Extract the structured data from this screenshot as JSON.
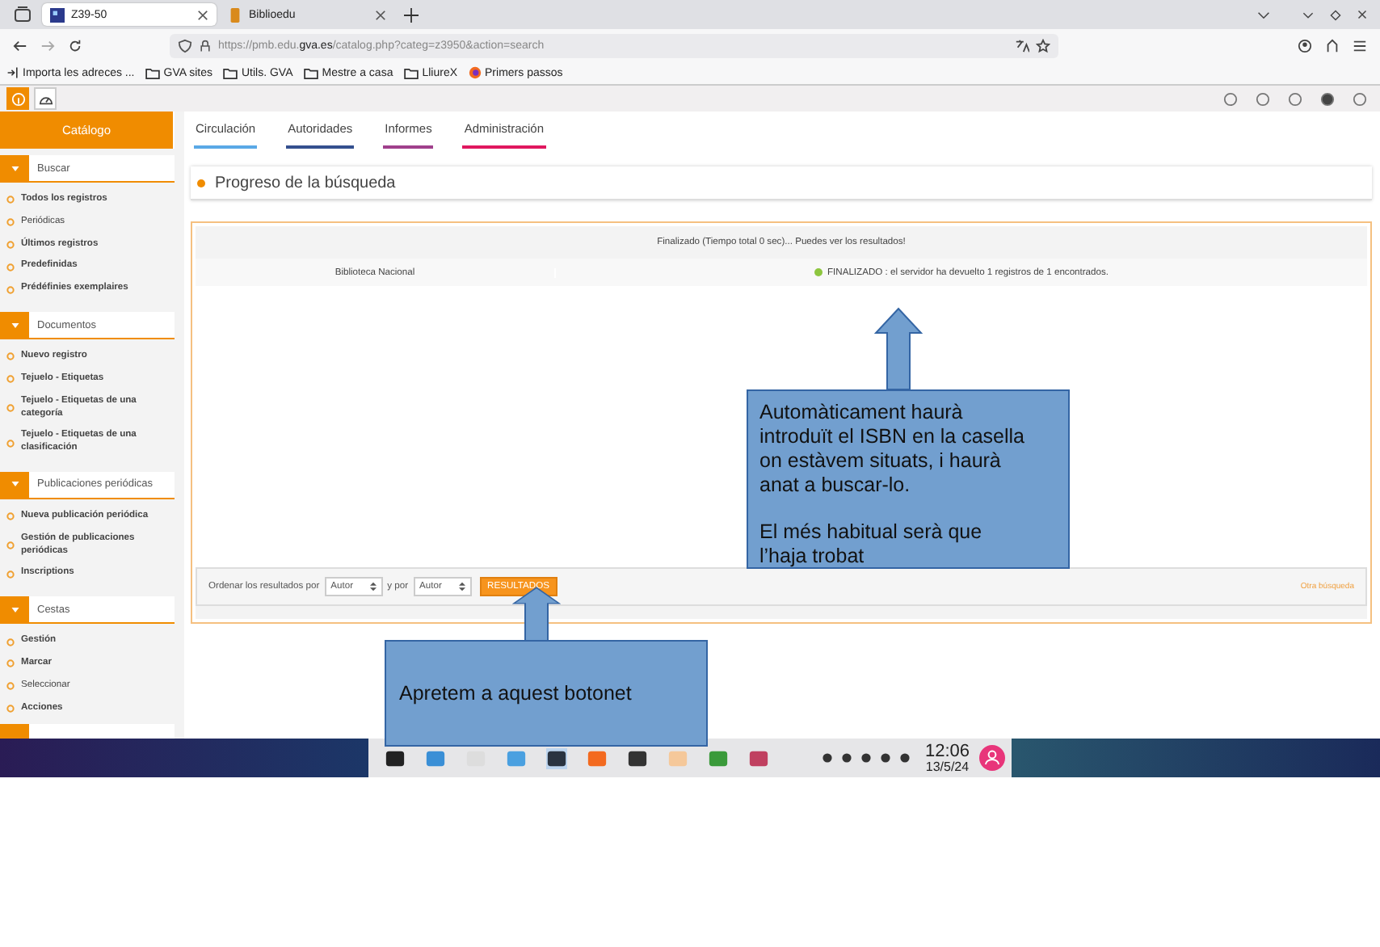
{
  "browser": {
    "tabs": [
      {
        "label": "Z39-50",
        "selected": true
      },
      {
        "label": "Biblioedu",
        "selected": false
      }
    ],
    "url": "https://pmb.edu.**gva.es**/catalog.php?categ=z3950&action=search",
    "bookmarks": [
      {
        "label": "Importa les adreces ...",
        "kind": "import"
      },
      {
        "label": "GVA sites",
        "kind": "folder"
      },
      {
        "label": "Utils. GVA",
        "kind": "folder"
      },
      {
        "label": "Mestre a casa",
        "kind": "folder"
      },
      {
        "label": "LliureX",
        "kind": "folder"
      },
      {
        "label": "Primers passos",
        "kind": "firefox"
      }
    ]
  },
  "app": {
    "module": "Catálogo",
    "nav": [
      {
        "label": "Circulación",
        "color": "#5aa9e6"
      },
      {
        "label": "Autoridades",
        "color": "#34508f"
      },
      {
        "label": "Informes",
        "color": "#a0408c"
      },
      {
        "label": "Administración",
        "color": "#e0185f"
      }
    ]
  },
  "sidebar": [
    {
      "title": "Buscar",
      "items": [
        {
          "label": "Todos los registros",
          "bold": true
        },
        {
          "label": "Periódicas",
          "bold": false
        },
        {
          "label": "Últimos registros",
          "bold": true
        },
        {
          "label": "Predefinidas",
          "bold": true
        },
        {
          "label": "Prédéfinies exemplaires",
          "bold": true
        }
      ]
    },
    {
      "title": "Documentos",
      "items": [
        {
          "label": "Nuevo registro",
          "bold": true
        },
        {
          "label": "Tejuelo - Etiquetas",
          "bold": true
        },
        {
          "label": "Tejuelo - Etiquetas de una categoría",
          "bold": true
        },
        {
          "label": "Tejuelo - Etiquetas de una clasificación",
          "bold": true
        }
      ]
    },
    {
      "title": "Publicaciones periódicas",
      "items": [
        {
          "label": "Nueva publicación periódica",
          "bold": true
        },
        {
          "label": "Gestión de publicaciones periódicas",
          "bold": true
        },
        {
          "label": "Inscriptions",
          "bold": true
        }
      ]
    },
    {
      "title": "Cestas",
      "items": [
        {
          "label": "Gestión",
          "bold": true
        },
        {
          "label": "Marcar",
          "bold": true
        },
        {
          "label": "Seleccionar",
          "bold": false
        },
        {
          "label": "Acciones",
          "bold": true
        }
      ]
    }
  ],
  "page_title": "Progreso de la búsqueda",
  "status_message": "Finalizado (Tiempo total 0 sec)... Puedes ver los resultados!",
  "rows": [
    {
      "source": "Biblioteca Nacional",
      "status": "FINALIZADO : el servidor ha devuelto 1 registros de 1 encontrados.",
      "color": "#8dc63f"
    }
  ],
  "sort": {
    "label": "Ordenar los resultados por",
    "select_1": "Autor",
    "connector": "y por",
    "select_2": "Autor",
    "button": "RESULTADOS",
    "link": "Otra búsqueda"
  },
  "callouts": [
    {
      "paragraphs": [
        "Automàticament haurà introduït el ISBN en la casella on estàvem situats, i haurà anat a buscar-lo.",
        "El més habitual serà que l’haja trobat"
      ]
    },
    {
      "paragraphs": [
        "Apretem a aquest botonet"
      ]
    }
  ],
  "taskbar": {
    "time": "12:06",
    "date": "13/5/24"
  }
}
